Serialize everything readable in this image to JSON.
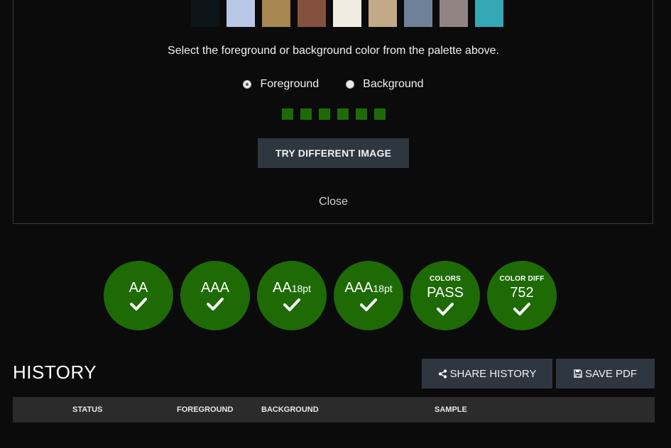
{
  "palette": {
    "swatches": [
      "#0d1418",
      "#b9c6e6",
      "#a8864f",
      "#84513f",
      "#f1ece1",
      "#c2aa87",
      "#6e8198",
      "#918483",
      "#34a8b4"
    ]
  },
  "picker": {
    "instructions": "Select the foreground or background color from the palette above.",
    "foreground_label": "Foreground",
    "background_label": "Background",
    "selected": "Foreground",
    "mini_swatches": [
      "#1e6b06",
      "#1e6b06",
      "#1e6b06",
      "#1e6b06",
      "#1e6b06",
      "#1e6b06"
    ],
    "try_button": "TRY DIFFERENT IMAGE",
    "close": "Close"
  },
  "results": {
    "badge_color": "#1e6b06",
    "aa": "AA",
    "aaa": "AAA",
    "aa18_main": "AA",
    "aa18_sub": "18pt",
    "aaa18_main": "AAA",
    "aaa18_sub": "18pt",
    "colors_label": "COLORS",
    "colors_value": "PASS",
    "diff_label": "COLOR DIFF",
    "diff_value": "752"
  },
  "history": {
    "title": "HISTORY",
    "share_button": "SHARE HISTORY",
    "pdf_button": "SAVE PDF",
    "columns": [
      "STATUS",
      "FOREGROUND",
      "BACKGROUND",
      "SAMPLE"
    ]
  }
}
